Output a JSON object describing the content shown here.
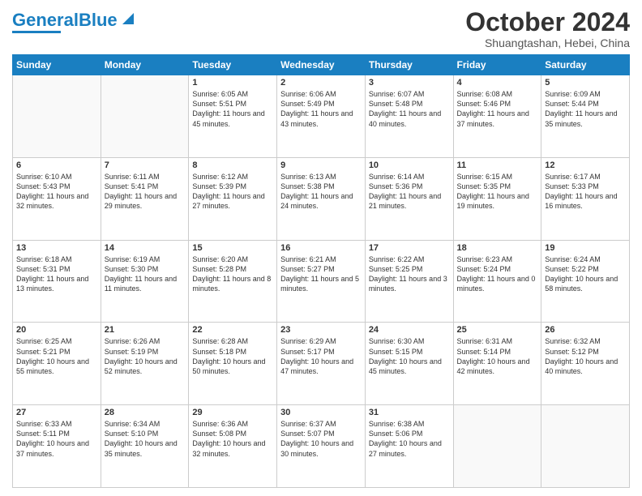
{
  "header": {
    "logo_general": "General",
    "logo_blue": "Blue",
    "month_title": "October 2024",
    "subtitle": "Shuangtashan, Hebei, China"
  },
  "weekdays": [
    "Sunday",
    "Monday",
    "Tuesday",
    "Wednesday",
    "Thursday",
    "Friday",
    "Saturday"
  ],
  "weeks": [
    [
      {
        "day": "",
        "content": ""
      },
      {
        "day": "",
        "content": ""
      },
      {
        "day": "1",
        "content": "Sunrise: 6:05 AM\nSunset: 5:51 PM\nDaylight: 11 hours and 45 minutes."
      },
      {
        "day": "2",
        "content": "Sunrise: 6:06 AM\nSunset: 5:49 PM\nDaylight: 11 hours and 43 minutes."
      },
      {
        "day": "3",
        "content": "Sunrise: 6:07 AM\nSunset: 5:48 PM\nDaylight: 11 hours and 40 minutes."
      },
      {
        "day": "4",
        "content": "Sunrise: 6:08 AM\nSunset: 5:46 PM\nDaylight: 11 hours and 37 minutes."
      },
      {
        "day": "5",
        "content": "Sunrise: 6:09 AM\nSunset: 5:44 PM\nDaylight: 11 hours and 35 minutes."
      }
    ],
    [
      {
        "day": "6",
        "content": "Sunrise: 6:10 AM\nSunset: 5:43 PM\nDaylight: 11 hours and 32 minutes."
      },
      {
        "day": "7",
        "content": "Sunrise: 6:11 AM\nSunset: 5:41 PM\nDaylight: 11 hours and 29 minutes."
      },
      {
        "day": "8",
        "content": "Sunrise: 6:12 AM\nSunset: 5:39 PM\nDaylight: 11 hours and 27 minutes."
      },
      {
        "day": "9",
        "content": "Sunrise: 6:13 AM\nSunset: 5:38 PM\nDaylight: 11 hours and 24 minutes."
      },
      {
        "day": "10",
        "content": "Sunrise: 6:14 AM\nSunset: 5:36 PM\nDaylight: 11 hours and 21 minutes."
      },
      {
        "day": "11",
        "content": "Sunrise: 6:15 AM\nSunset: 5:35 PM\nDaylight: 11 hours and 19 minutes."
      },
      {
        "day": "12",
        "content": "Sunrise: 6:17 AM\nSunset: 5:33 PM\nDaylight: 11 hours and 16 minutes."
      }
    ],
    [
      {
        "day": "13",
        "content": "Sunrise: 6:18 AM\nSunset: 5:31 PM\nDaylight: 11 hours and 13 minutes."
      },
      {
        "day": "14",
        "content": "Sunrise: 6:19 AM\nSunset: 5:30 PM\nDaylight: 11 hours and 11 minutes."
      },
      {
        "day": "15",
        "content": "Sunrise: 6:20 AM\nSunset: 5:28 PM\nDaylight: 11 hours and 8 minutes."
      },
      {
        "day": "16",
        "content": "Sunrise: 6:21 AM\nSunset: 5:27 PM\nDaylight: 11 hours and 5 minutes."
      },
      {
        "day": "17",
        "content": "Sunrise: 6:22 AM\nSunset: 5:25 PM\nDaylight: 11 hours and 3 minutes."
      },
      {
        "day": "18",
        "content": "Sunrise: 6:23 AM\nSunset: 5:24 PM\nDaylight: 11 hours and 0 minutes."
      },
      {
        "day": "19",
        "content": "Sunrise: 6:24 AM\nSunset: 5:22 PM\nDaylight: 10 hours and 58 minutes."
      }
    ],
    [
      {
        "day": "20",
        "content": "Sunrise: 6:25 AM\nSunset: 5:21 PM\nDaylight: 10 hours and 55 minutes."
      },
      {
        "day": "21",
        "content": "Sunrise: 6:26 AM\nSunset: 5:19 PM\nDaylight: 10 hours and 52 minutes."
      },
      {
        "day": "22",
        "content": "Sunrise: 6:28 AM\nSunset: 5:18 PM\nDaylight: 10 hours and 50 minutes."
      },
      {
        "day": "23",
        "content": "Sunrise: 6:29 AM\nSunset: 5:17 PM\nDaylight: 10 hours and 47 minutes."
      },
      {
        "day": "24",
        "content": "Sunrise: 6:30 AM\nSunset: 5:15 PM\nDaylight: 10 hours and 45 minutes."
      },
      {
        "day": "25",
        "content": "Sunrise: 6:31 AM\nSunset: 5:14 PM\nDaylight: 10 hours and 42 minutes."
      },
      {
        "day": "26",
        "content": "Sunrise: 6:32 AM\nSunset: 5:12 PM\nDaylight: 10 hours and 40 minutes."
      }
    ],
    [
      {
        "day": "27",
        "content": "Sunrise: 6:33 AM\nSunset: 5:11 PM\nDaylight: 10 hours and 37 minutes."
      },
      {
        "day": "28",
        "content": "Sunrise: 6:34 AM\nSunset: 5:10 PM\nDaylight: 10 hours and 35 minutes."
      },
      {
        "day": "29",
        "content": "Sunrise: 6:36 AM\nSunset: 5:08 PM\nDaylight: 10 hours and 32 minutes."
      },
      {
        "day": "30",
        "content": "Sunrise: 6:37 AM\nSunset: 5:07 PM\nDaylight: 10 hours and 30 minutes."
      },
      {
        "day": "31",
        "content": "Sunrise: 6:38 AM\nSunset: 5:06 PM\nDaylight: 10 hours and 27 minutes."
      },
      {
        "day": "",
        "content": ""
      },
      {
        "day": "",
        "content": ""
      }
    ]
  ]
}
